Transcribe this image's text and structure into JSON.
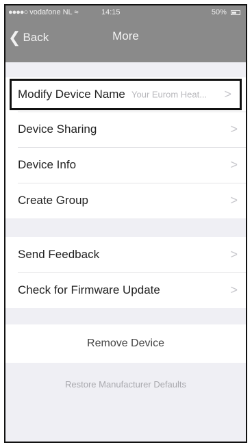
{
  "status_bar": {
    "carrier": "vodafone NL",
    "time": "14:15",
    "battery": "50%"
  },
  "nav": {
    "back_label": "Back",
    "title": "More"
  },
  "section1": {
    "items": [
      {
        "label": "Modify Device Name",
        "value": "Your Eurom Heat..."
      },
      {
        "label": "Device Sharing"
      },
      {
        "label": "Device Info"
      },
      {
        "label": "Create Group"
      }
    ]
  },
  "section2": {
    "items": [
      {
        "label": "Send Feedback"
      },
      {
        "label": "Check for Firmware Update"
      }
    ]
  },
  "remove_device": "Remove Device",
  "restore_defaults": "Restore Manufacturer Defaults",
  "chevron": ">",
  "colors": {
    "nav_bar": "#8a8a8a",
    "background": "#efeff4",
    "highlight_border": "#111111"
  }
}
